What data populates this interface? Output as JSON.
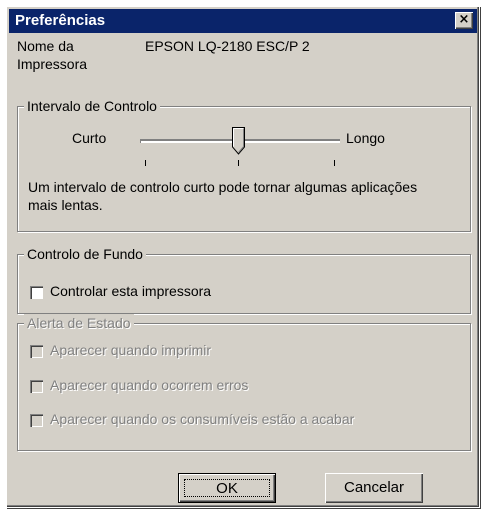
{
  "window": {
    "title": "Preferências",
    "close_glyph": "×"
  },
  "printer": {
    "name_label_line1": "Nome da",
    "name_label_line2": "Impressora",
    "name_value": "EPSON LQ-2180 ESC/P 2"
  },
  "interval_group": {
    "legend": "Intervalo de Controlo",
    "slider_min_label": "Curto",
    "slider_max_label": "Longo",
    "slider_value_fraction": 0.5,
    "hint_line1": "Um intervalo de controlo curto pode tornar algumas aplicações",
    "hint_line2": "mais lentas."
  },
  "background_group": {
    "legend": "Controlo de Fundo",
    "monitor_checkbox_label": "Controlar esta impressora",
    "monitor_checked": false
  },
  "status_alert_group": {
    "legend": "Alerta de Estado",
    "enabled": false,
    "options": [
      {
        "label": "Aparecer quando imprimir",
        "checked": false
      },
      {
        "label": "Aparecer quando ocorrem erros",
        "checked": false
      },
      {
        "label": "Aparecer quando os consumíveis estão a acabar",
        "checked": false
      }
    ]
  },
  "buttons": {
    "ok_label": "OK",
    "cancel_label": "Cancelar"
  }
}
